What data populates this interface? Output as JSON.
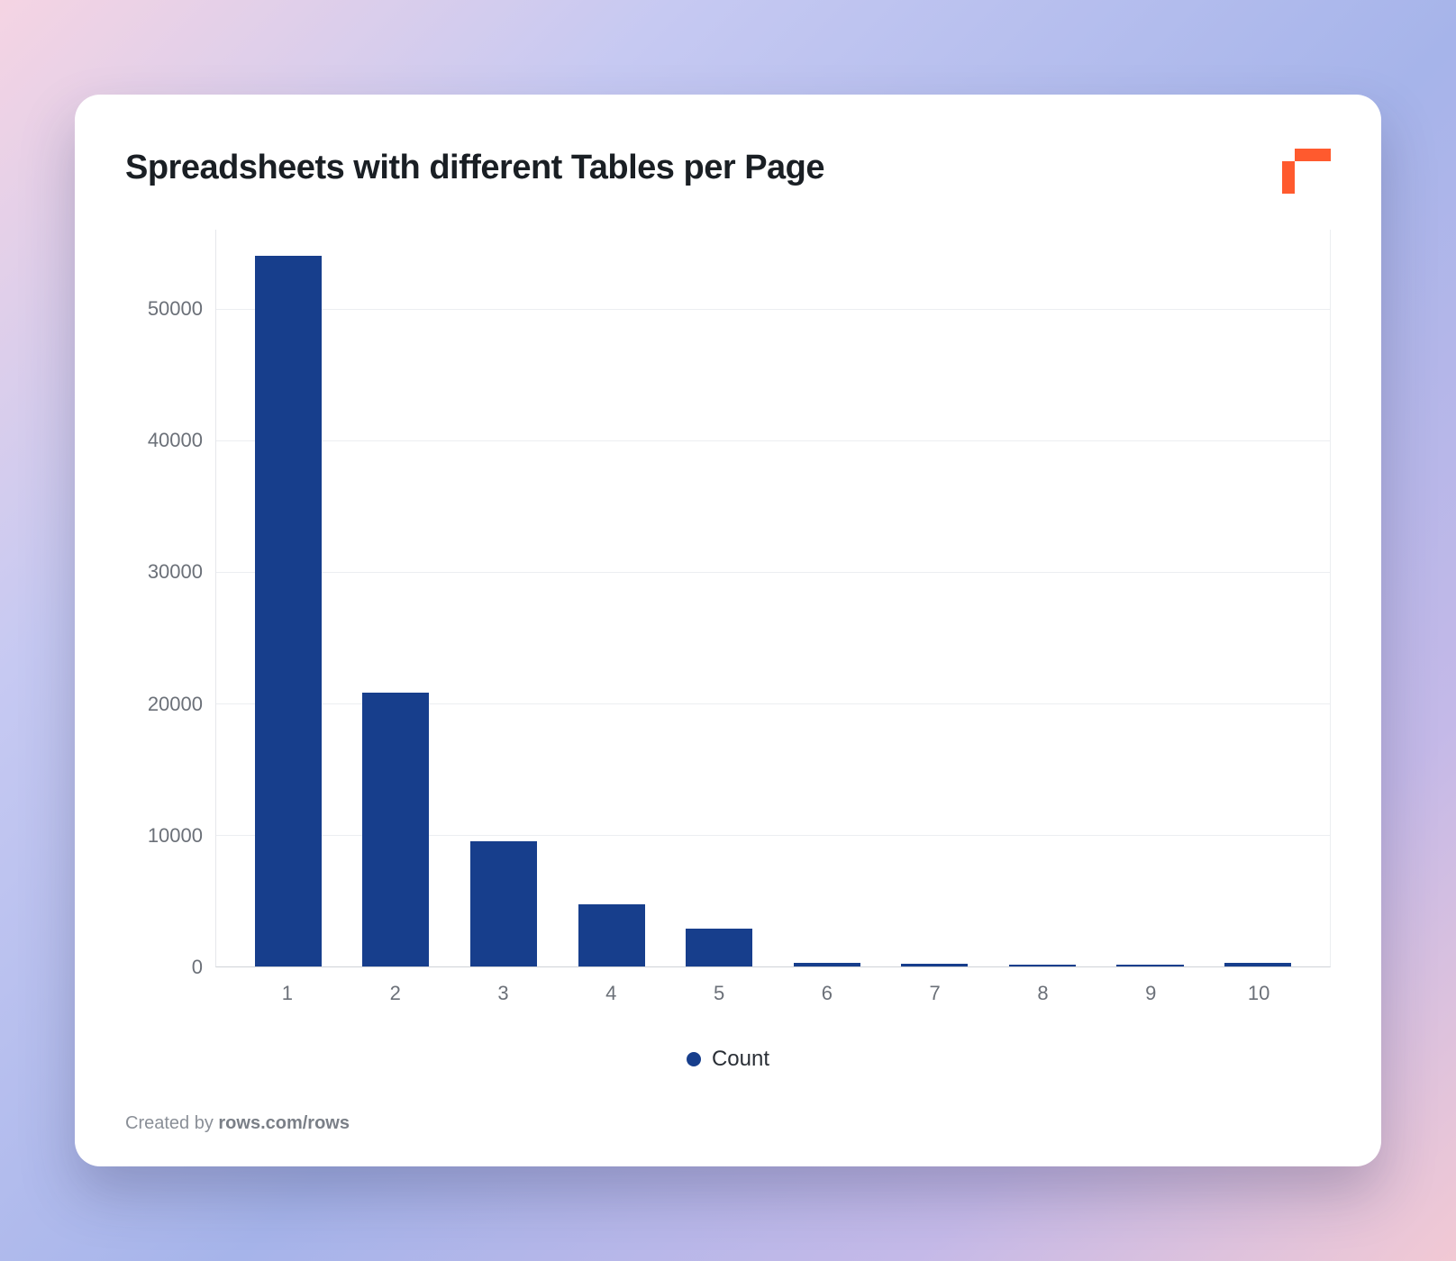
{
  "title": "Spreadsheets with different Tables per Page",
  "legend_label": "Count",
  "footer_prefix": "Created by ",
  "footer_link": "rows.com/rows",
  "colors": {
    "bar": "#173e8c",
    "accent": "#ff5a2e"
  },
  "chart_data": {
    "type": "bar",
    "title": "Spreadsheets with different Tables per Page",
    "xlabel": "",
    "ylabel": "",
    "categories": [
      "1",
      "2",
      "3",
      "4",
      "5",
      "6",
      "7",
      "8",
      "9",
      "10"
    ],
    "values": [
      54000,
      20800,
      9500,
      4700,
      2900,
      300,
      200,
      150,
      120,
      250
    ],
    "y_ticks": [
      0,
      10000,
      20000,
      30000,
      40000,
      50000
    ],
    "ylim": [
      0,
      56000
    ],
    "series_name": "Count"
  }
}
